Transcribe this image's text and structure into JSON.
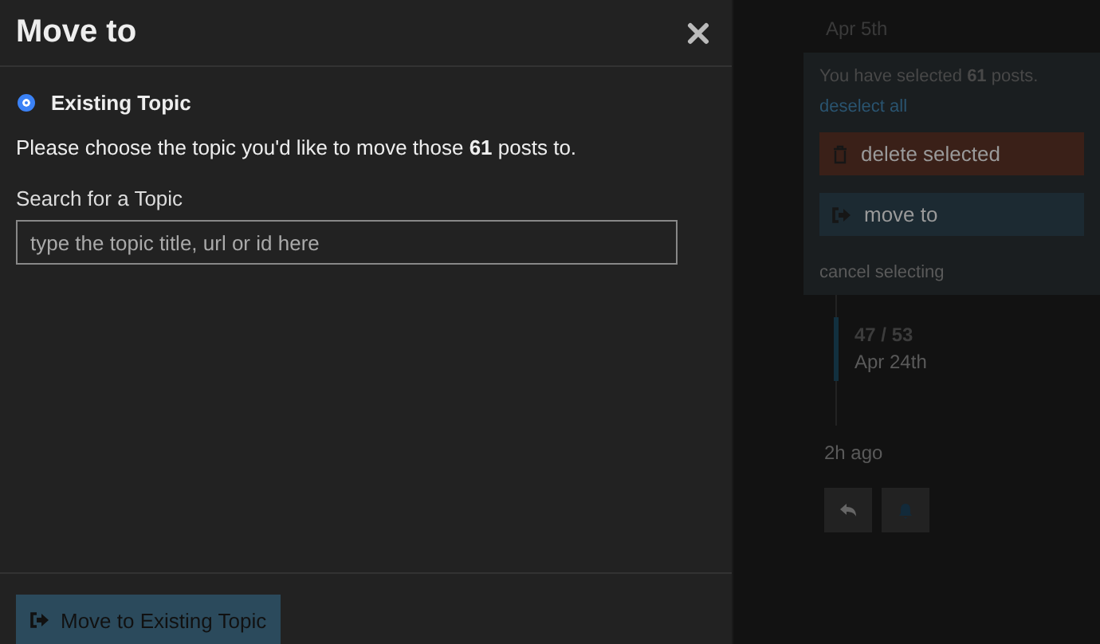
{
  "modal": {
    "title": "Move to",
    "options": [
      {
        "label": "Existing Topic",
        "selected": true
      }
    ],
    "instruction": "Please choose the topic you'd like to move those **61** posts to.",
    "search_label": "Search for a Topic",
    "search": {
      "placeholder": "type the topic title, url or id here"
    },
    "submit": "Move to Existing Topic"
  },
  "background": {
    "date": "Apr 5th",
    "selection": {
      "message": "You have selected **61** posts.",
      "deselect": "deselect all",
      "buttons": [
        {
          "kind": "delete",
          "label": "delete selected"
        },
        {
          "kind": "move",
          "label": "move to"
        }
      ],
      "cancel": "cancel selecting"
    },
    "timeline": {
      "position": "47 / 53",
      "date": "Apr 24th"
    },
    "last_activity": "2h ago",
    "actions": [
      {
        "kind": "reply"
      },
      {
        "kind": "bell"
      }
    ]
  }
}
